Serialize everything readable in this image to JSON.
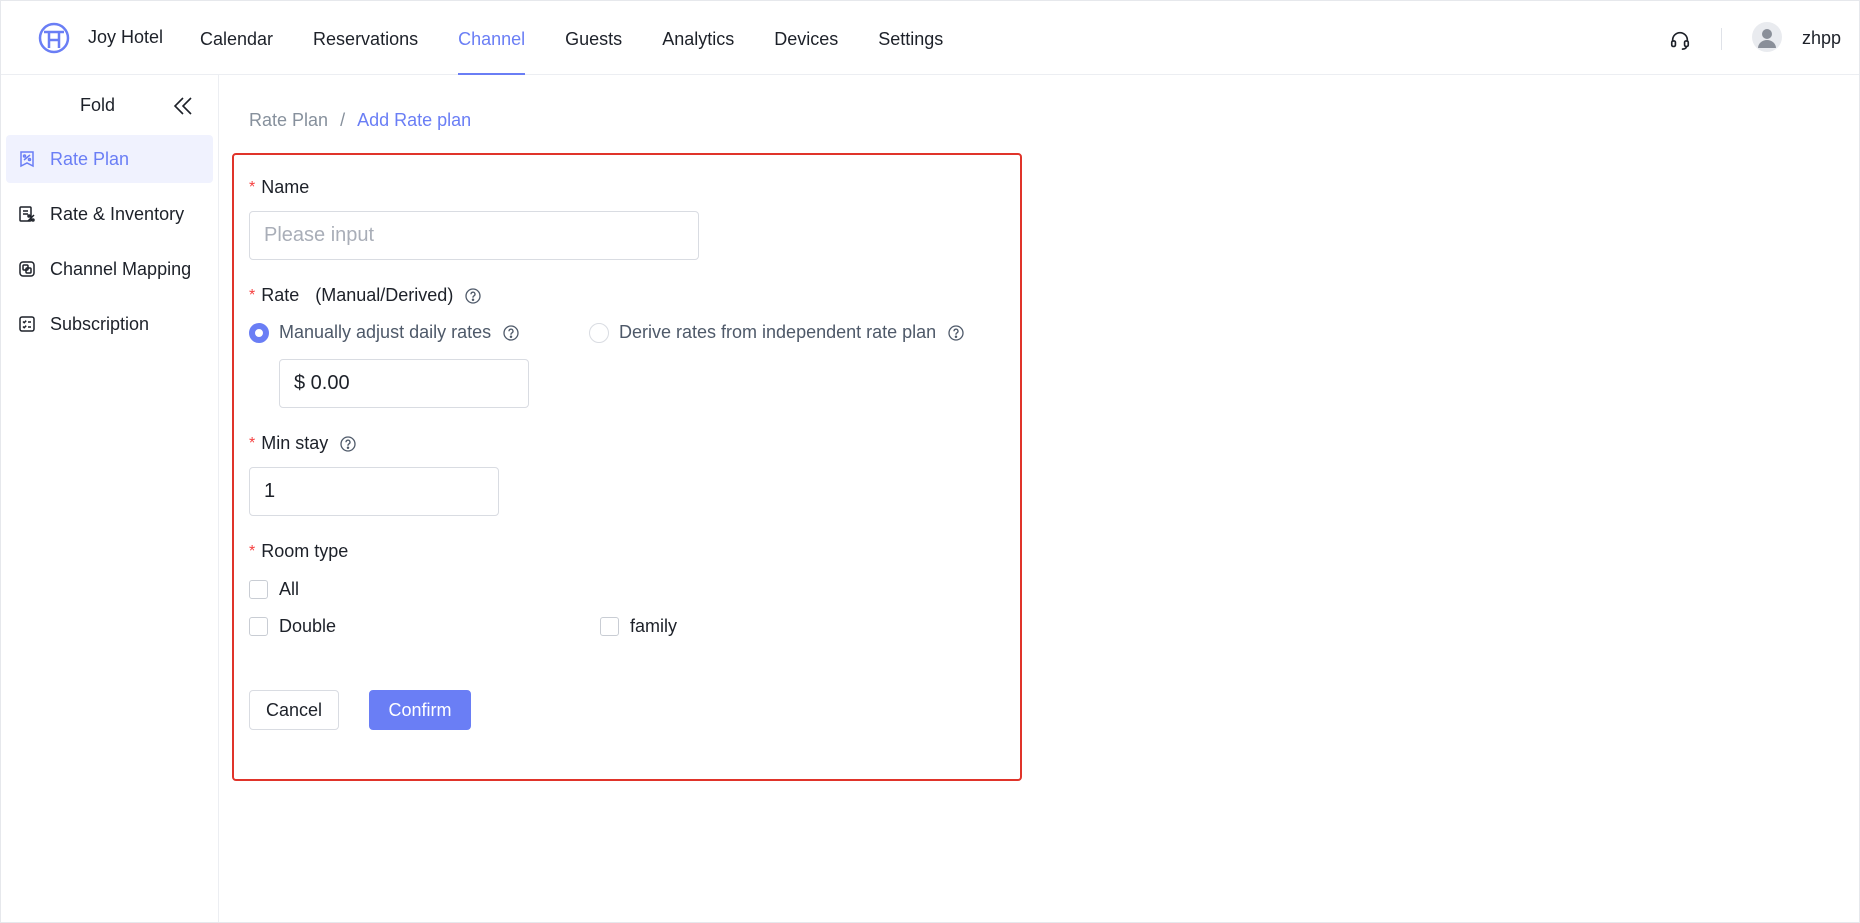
{
  "app": {
    "brand": "Joy Hotel",
    "logo_icon": "joy-hotel-logo",
    "accent_color": "#6a7ef5",
    "required_color": "#f53f3f"
  },
  "nav": {
    "items": [
      {
        "label": "Calendar"
      },
      {
        "label": "Reservations"
      },
      {
        "label": "Channel",
        "active": true
      },
      {
        "label": "Guests"
      },
      {
        "label": "Analytics"
      },
      {
        "label": "Devices"
      },
      {
        "label": "Settings"
      }
    ],
    "support_icon": "headset-icon",
    "username": "zhpp"
  },
  "sidebar": {
    "fold_label": "Fold",
    "fold_icon": "double-chevron-left-icon",
    "items": [
      {
        "label": "Rate Plan",
        "icon": "rate-plan-icon",
        "active": true
      },
      {
        "label": "Rate & Inventory",
        "icon": "rate-inventory-icon"
      },
      {
        "label": "Channel Mapping",
        "icon": "channel-mapping-icon"
      },
      {
        "label": "Subscription",
        "icon": "subscription-icon"
      }
    ]
  },
  "breadcrumb": {
    "parent": "Rate Plan",
    "separator": "/",
    "current": "Add Rate plan"
  },
  "form": {
    "name": {
      "required_mark": "*",
      "label": "Name",
      "placeholder": "Please input",
      "value": ""
    },
    "rate": {
      "required_mark": "*",
      "label": "Rate",
      "hint": "(Manual/Derived)",
      "options": [
        {
          "label": "Manually adjust daily rates",
          "selected": true
        },
        {
          "label": "Derive rates from independent rate plan",
          "selected": false
        }
      ],
      "value": "$ 0.00"
    },
    "min_stay": {
      "required_mark": "*",
      "label": "Min stay",
      "value": "1"
    },
    "room_type": {
      "required_mark": "*",
      "label": "Room type",
      "options": [
        {
          "label": "All",
          "checked": false
        },
        {
          "label": "Double",
          "checked": false
        },
        {
          "label": "family",
          "checked": false
        }
      ]
    },
    "cancel_label": "Cancel",
    "confirm_label": "Confirm"
  }
}
